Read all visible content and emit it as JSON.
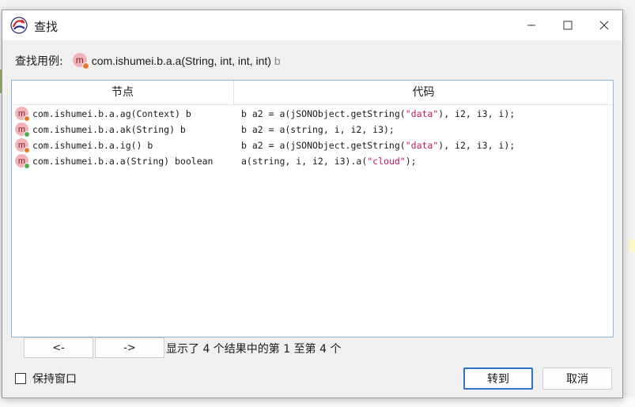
{
  "window": {
    "title": "查找",
    "controls": {
      "minimize": "—",
      "maximize": "☐",
      "close": "✕"
    }
  },
  "find_usages": {
    "label": "查找用例:",
    "method": "com.ishumei.b.a.a(String, int, int, int)",
    "return_type": "b"
  },
  "table": {
    "columns": [
      "节点",
      "代码"
    ],
    "rows": [
      {
        "node": "com.ishumei.b.a.ag(Context) b",
        "code": [
          {
            "t": "b a2 = a(jSONObject.getString("
          },
          {
            "t": "\"data\"",
            "s": true
          },
          {
            "t": "), i2, i3, i);"
          }
        ],
        "dot_color": "#e8772e"
      },
      {
        "node": "com.ishumei.b.a.ak(String) b",
        "code": [
          {
            "t": "b a2 = a(string, i, i2, i3);"
          }
        ],
        "dot_color": "#4caf50"
      },
      {
        "node": "com.ishumei.b.a.ig() b",
        "code": [
          {
            "t": "b a2 = a(jSONObject.getString("
          },
          {
            "t": "\"data\"",
            "s": true
          },
          {
            "t": "), i2, i3, i);"
          }
        ],
        "dot_color": "#e8772e"
      },
      {
        "node": "com.ishumei.b.a.a(String) boolean",
        "code": [
          {
            "t": "a(string, i, i2, i3).a("
          },
          {
            "t": "\"cloud\"",
            "s": true
          },
          {
            "t": ");"
          }
        ],
        "dot_color": "#4caf50"
      }
    ]
  },
  "icons": {
    "method_letter": "m",
    "header_dot_color": "#e8772e"
  },
  "pagination": {
    "prev_label": "<-",
    "next_label": "->",
    "status": "显示了 4 个结果中的第 1 至第 4 个"
  },
  "footer": {
    "keep_window_label": "保持窗口",
    "keep_window_checked": false,
    "goto_label": "转到",
    "cancel_label": "取消"
  },
  "colors": {
    "accent": "#2b73c7",
    "string_literal": "#c2185b"
  }
}
